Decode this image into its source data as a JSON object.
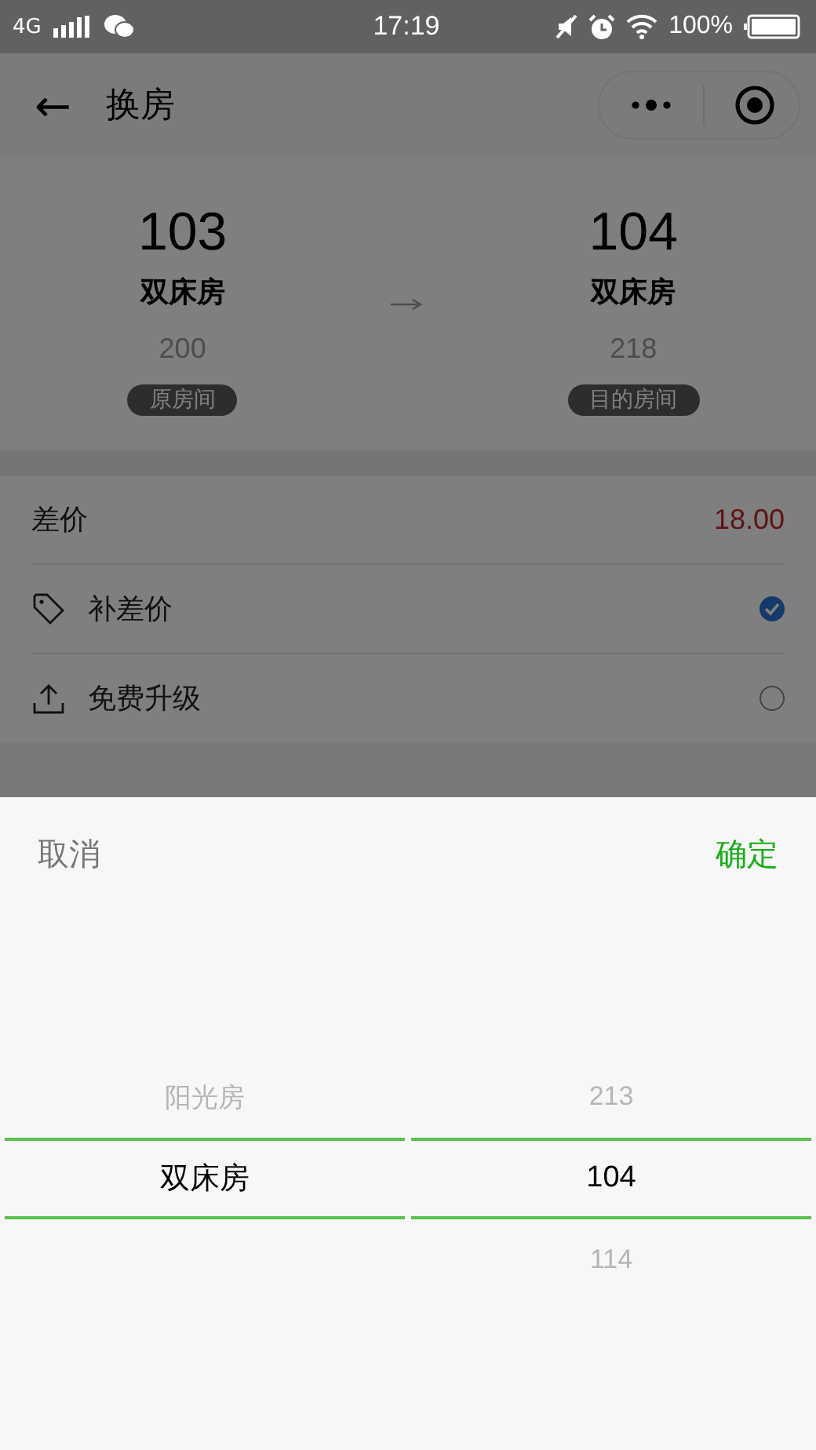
{
  "status_bar": {
    "network": "4G",
    "time": "17:19",
    "battery": "100%"
  },
  "nav": {
    "title": "换房",
    "back": "←"
  },
  "rooms": [
    {
      "number": "103",
      "type": "双床房",
      "price": "200",
      "tag": "原房间"
    },
    {
      "number": "104",
      "type": "双床房",
      "price": "218",
      "tag": "目的房间"
    }
  ],
  "difference": {
    "label": "差价",
    "value": "18.00"
  },
  "options": [
    {
      "label": "补差价",
      "checked": true
    },
    {
      "label": "免费升级",
      "checked": false
    }
  ],
  "sheet": {
    "cancel": "取消",
    "confirm": "确定",
    "columns": [
      {
        "items": [
          {
            "label": "阳光房",
            "selected": false
          },
          {
            "label": "双床房",
            "selected": true
          }
        ]
      },
      {
        "items": [
          {
            "label": "213",
            "selected": false
          },
          {
            "label": "104",
            "selected": true
          },
          {
            "label": "114",
            "selected": false
          }
        ]
      }
    ]
  }
}
